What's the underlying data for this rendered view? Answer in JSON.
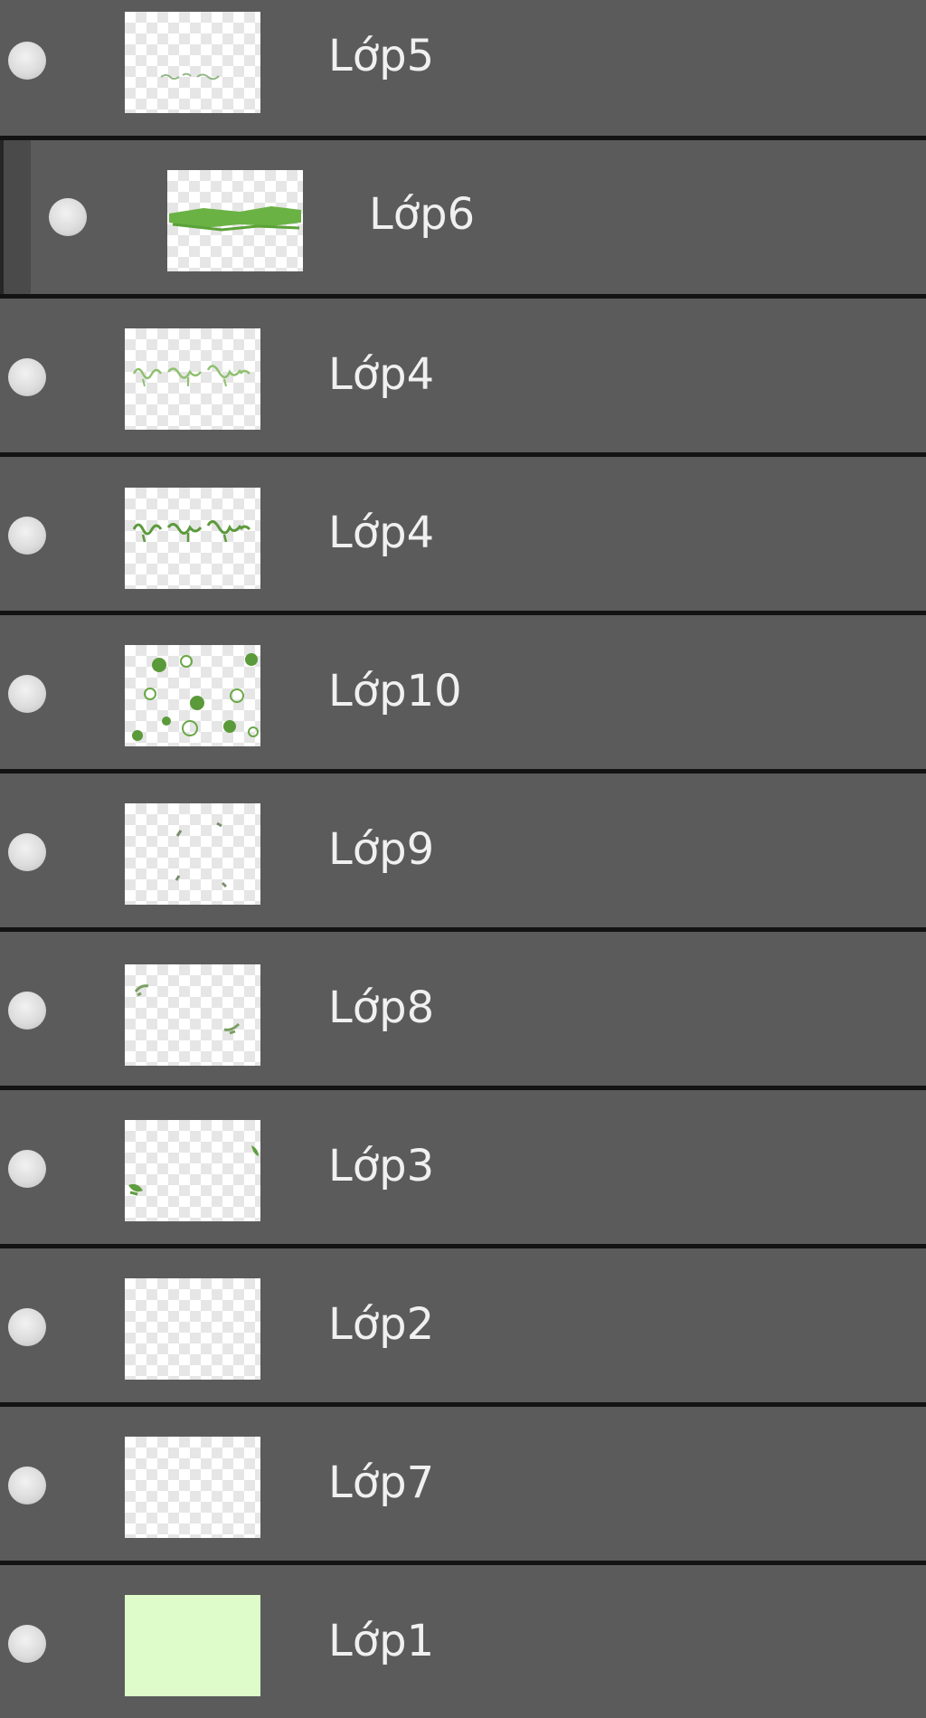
{
  "layers_panel": {
    "layers": [
      {
        "name": "Lớp5",
        "visible": true,
        "clipped": false,
        "thumbnail": "faint-text-sketch"
      },
      {
        "name": "Lớp6",
        "visible": true,
        "clipped": true,
        "thumbnail": "green-horizontal-stroke"
      },
      {
        "name": "Lớp4",
        "visible": true,
        "clipped": false,
        "thumbnail": "light-green-handwriting"
      },
      {
        "name": "Lớp4",
        "visible": true,
        "clipped": false,
        "thumbnail": "green-handwriting"
      },
      {
        "name": "Lớp10",
        "visible": true,
        "clipped": false,
        "thumbnail": "green-circles-pattern"
      },
      {
        "name": "Lớp9",
        "visible": true,
        "clipped": false,
        "thumbnail": "sparse-marks"
      },
      {
        "name": "Lớp8",
        "visible": true,
        "clipped": false,
        "thumbnail": "corner-marks"
      },
      {
        "name": "Lớp3",
        "visible": true,
        "clipped": false,
        "thumbnail": "edge-leaves"
      },
      {
        "name": "Lớp2",
        "visible": true,
        "clipped": false,
        "thumbnail": "transparent"
      },
      {
        "name": "Lớp7",
        "visible": true,
        "clipped": false,
        "thumbnail": "transparent"
      },
      {
        "name": "Lớp1",
        "visible": true,
        "clipped": false,
        "thumbnail": "solid-light-green"
      }
    ]
  },
  "colors": {
    "panel_bg": "#5b5b5b",
    "separator": "#131313",
    "text": "#f0f0f0",
    "thumb_green": "#6bb245",
    "thumb_light_green": "#ddfcca"
  }
}
